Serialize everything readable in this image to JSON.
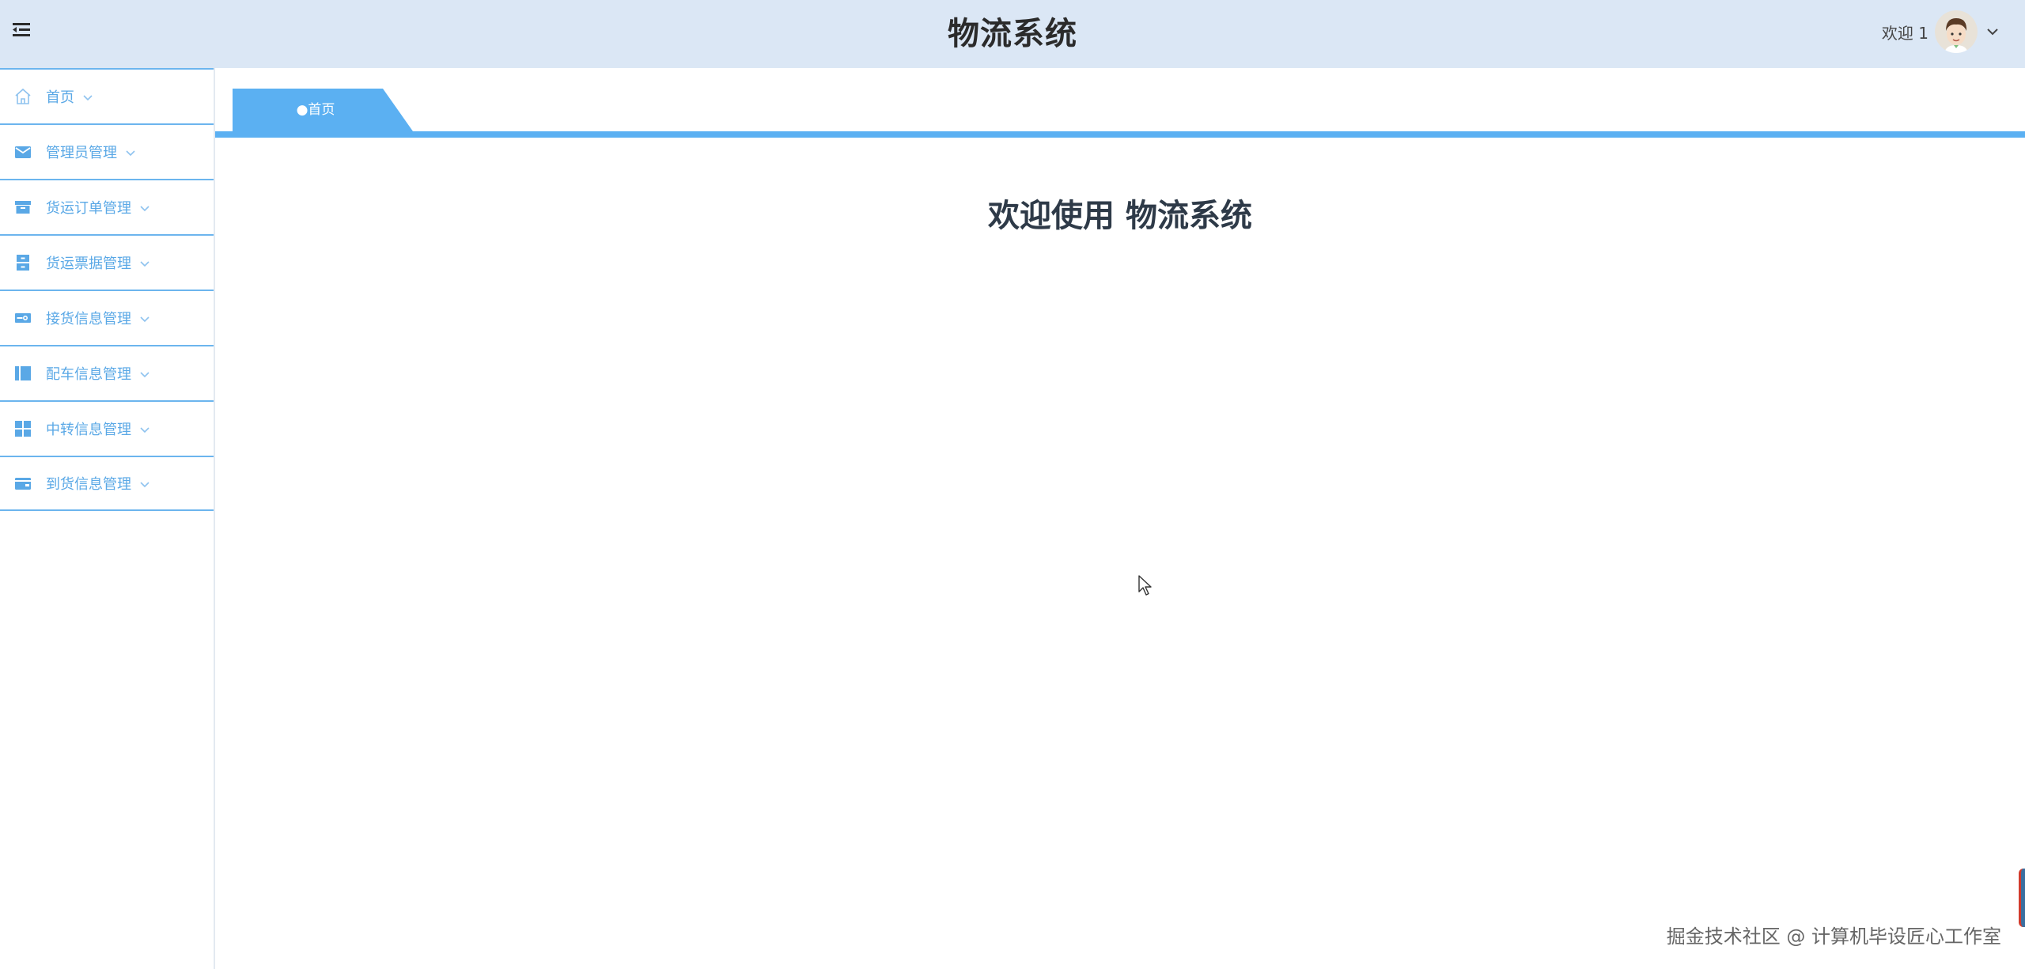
{
  "header": {
    "title": "物流系统",
    "welcome": "欢迎 1",
    "avatar_icon": "user-avatar"
  },
  "sidebar": {
    "items": [
      {
        "label": "首页",
        "icon": "home-icon"
      },
      {
        "label": "管理员管理",
        "icon": "envelope-icon"
      },
      {
        "label": "货运订单管理",
        "icon": "archive-box-icon"
      },
      {
        "label": "货运票据管理",
        "icon": "cabinet-icon"
      },
      {
        "label": "接货信息管理",
        "icon": "ticket-icon"
      },
      {
        "label": "配车信息管理",
        "icon": "columns-icon"
      },
      {
        "label": "中转信息管理",
        "icon": "grid-icon"
      },
      {
        "label": "到货信息管理",
        "icon": "wallet-icon"
      }
    ]
  },
  "tabs": [
    {
      "label": "●首页",
      "active": true
    }
  ],
  "main": {
    "welcome_heading": "欢迎使用 物流系统"
  },
  "watermark": "掘金技术社区 @ 计算机毕设匠心工作室",
  "colors": {
    "header_bg": "#dbe7f5",
    "accent": "#5bb0f2",
    "sidebar_text": "#5aa8e6",
    "sidebar_divider": "#6cb5ee"
  }
}
